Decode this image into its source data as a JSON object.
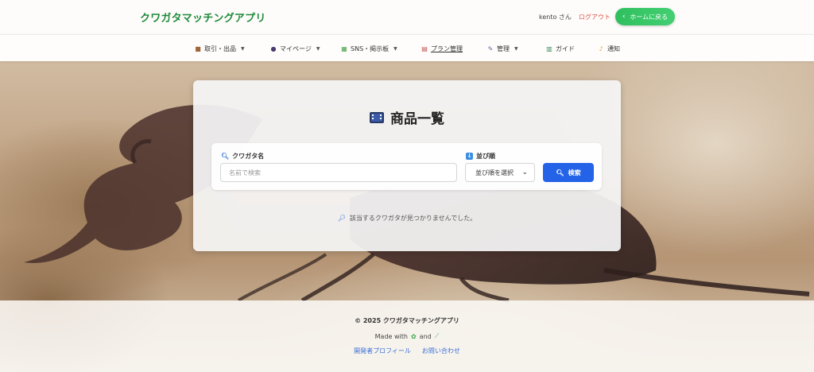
{
  "header": {
    "brand": "クワガタマッチングアプリ",
    "user_greeting": "kento さん",
    "logout_label": "ログアウト",
    "home_button_label": "ホームに戻る"
  },
  "nav": {
    "items": [
      {
        "label": "取引・出品",
        "icon": "package-icon",
        "dropdown": true
      },
      {
        "label": "マイページ",
        "icon": "user-icon",
        "dropdown": true
      },
      {
        "label": "SNS・掲示板",
        "icon": "image-icon",
        "dropdown": true
      },
      {
        "label": "プラン管理",
        "icon": "plan-icon",
        "dropdown": false
      },
      {
        "label": "管理",
        "icon": "tools-icon",
        "dropdown": true
      },
      {
        "label": "ガイド",
        "icon": "book-icon",
        "dropdown": false
      },
      {
        "label": "通知",
        "icon": "bell-icon",
        "dropdown": false
      }
    ]
  },
  "main": {
    "title": "商品一覧",
    "search": {
      "name_label": "クワガタ名",
      "name_placeholder": "名前で検索",
      "name_value": "",
      "sort_label": "並び順",
      "sort_selected": "並び順を選択",
      "search_button_label": "検索"
    },
    "empty_message": "該当するクワガタが見つかりませんでした。"
  },
  "footer": {
    "copyright": "© 2025 クワガタマッチングアプリ",
    "made_with_prefix": "Made with",
    "made_with_and": "and",
    "links": [
      "開発者プロフィール",
      "お問い合わせ"
    ]
  },
  "colors": {
    "brand": "#1f8a3b",
    "logout": "#e0524c",
    "home_button": "#2fbf5e",
    "search_button": "#2463e8",
    "link": "#3a6fd8"
  }
}
